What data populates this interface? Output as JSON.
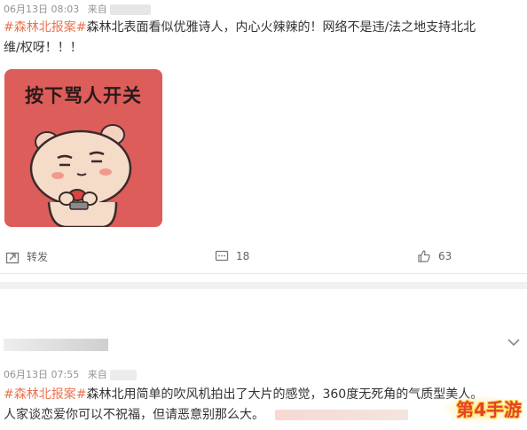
{
  "post1": {
    "timestamp": "06月13日 08:03",
    "source_prefix": "来自",
    "hashtag": "#森林北报案#",
    "text_line1": "森林北表面看似优雅诗人，内心火辣辣的！网络不是违/法之地支持北北",
    "text_line2": "维/权呀！！！",
    "sticker_caption": "按下骂人开关",
    "actions": {
      "repost_label": "转发",
      "comment_count": "18",
      "like_count": "63"
    }
  },
  "post2": {
    "timestamp": "06月13日 07:55",
    "source_prefix": "来自",
    "hashtag": "#森林北报案#",
    "text_line1": "森林北用简单的吹风机拍出了大片的感觉，360度无死角的气质型美人。",
    "text_line2": "人家谈恋爱你可以不祝福，但请恶意别那么大。"
  },
  "watermark": {
    "text": "第4手游"
  },
  "colors": {
    "hashtag": "#eb7350",
    "sticker_bg": "#dc5d5a",
    "meta_text": "#939393",
    "watermark": "#e3422b"
  }
}
